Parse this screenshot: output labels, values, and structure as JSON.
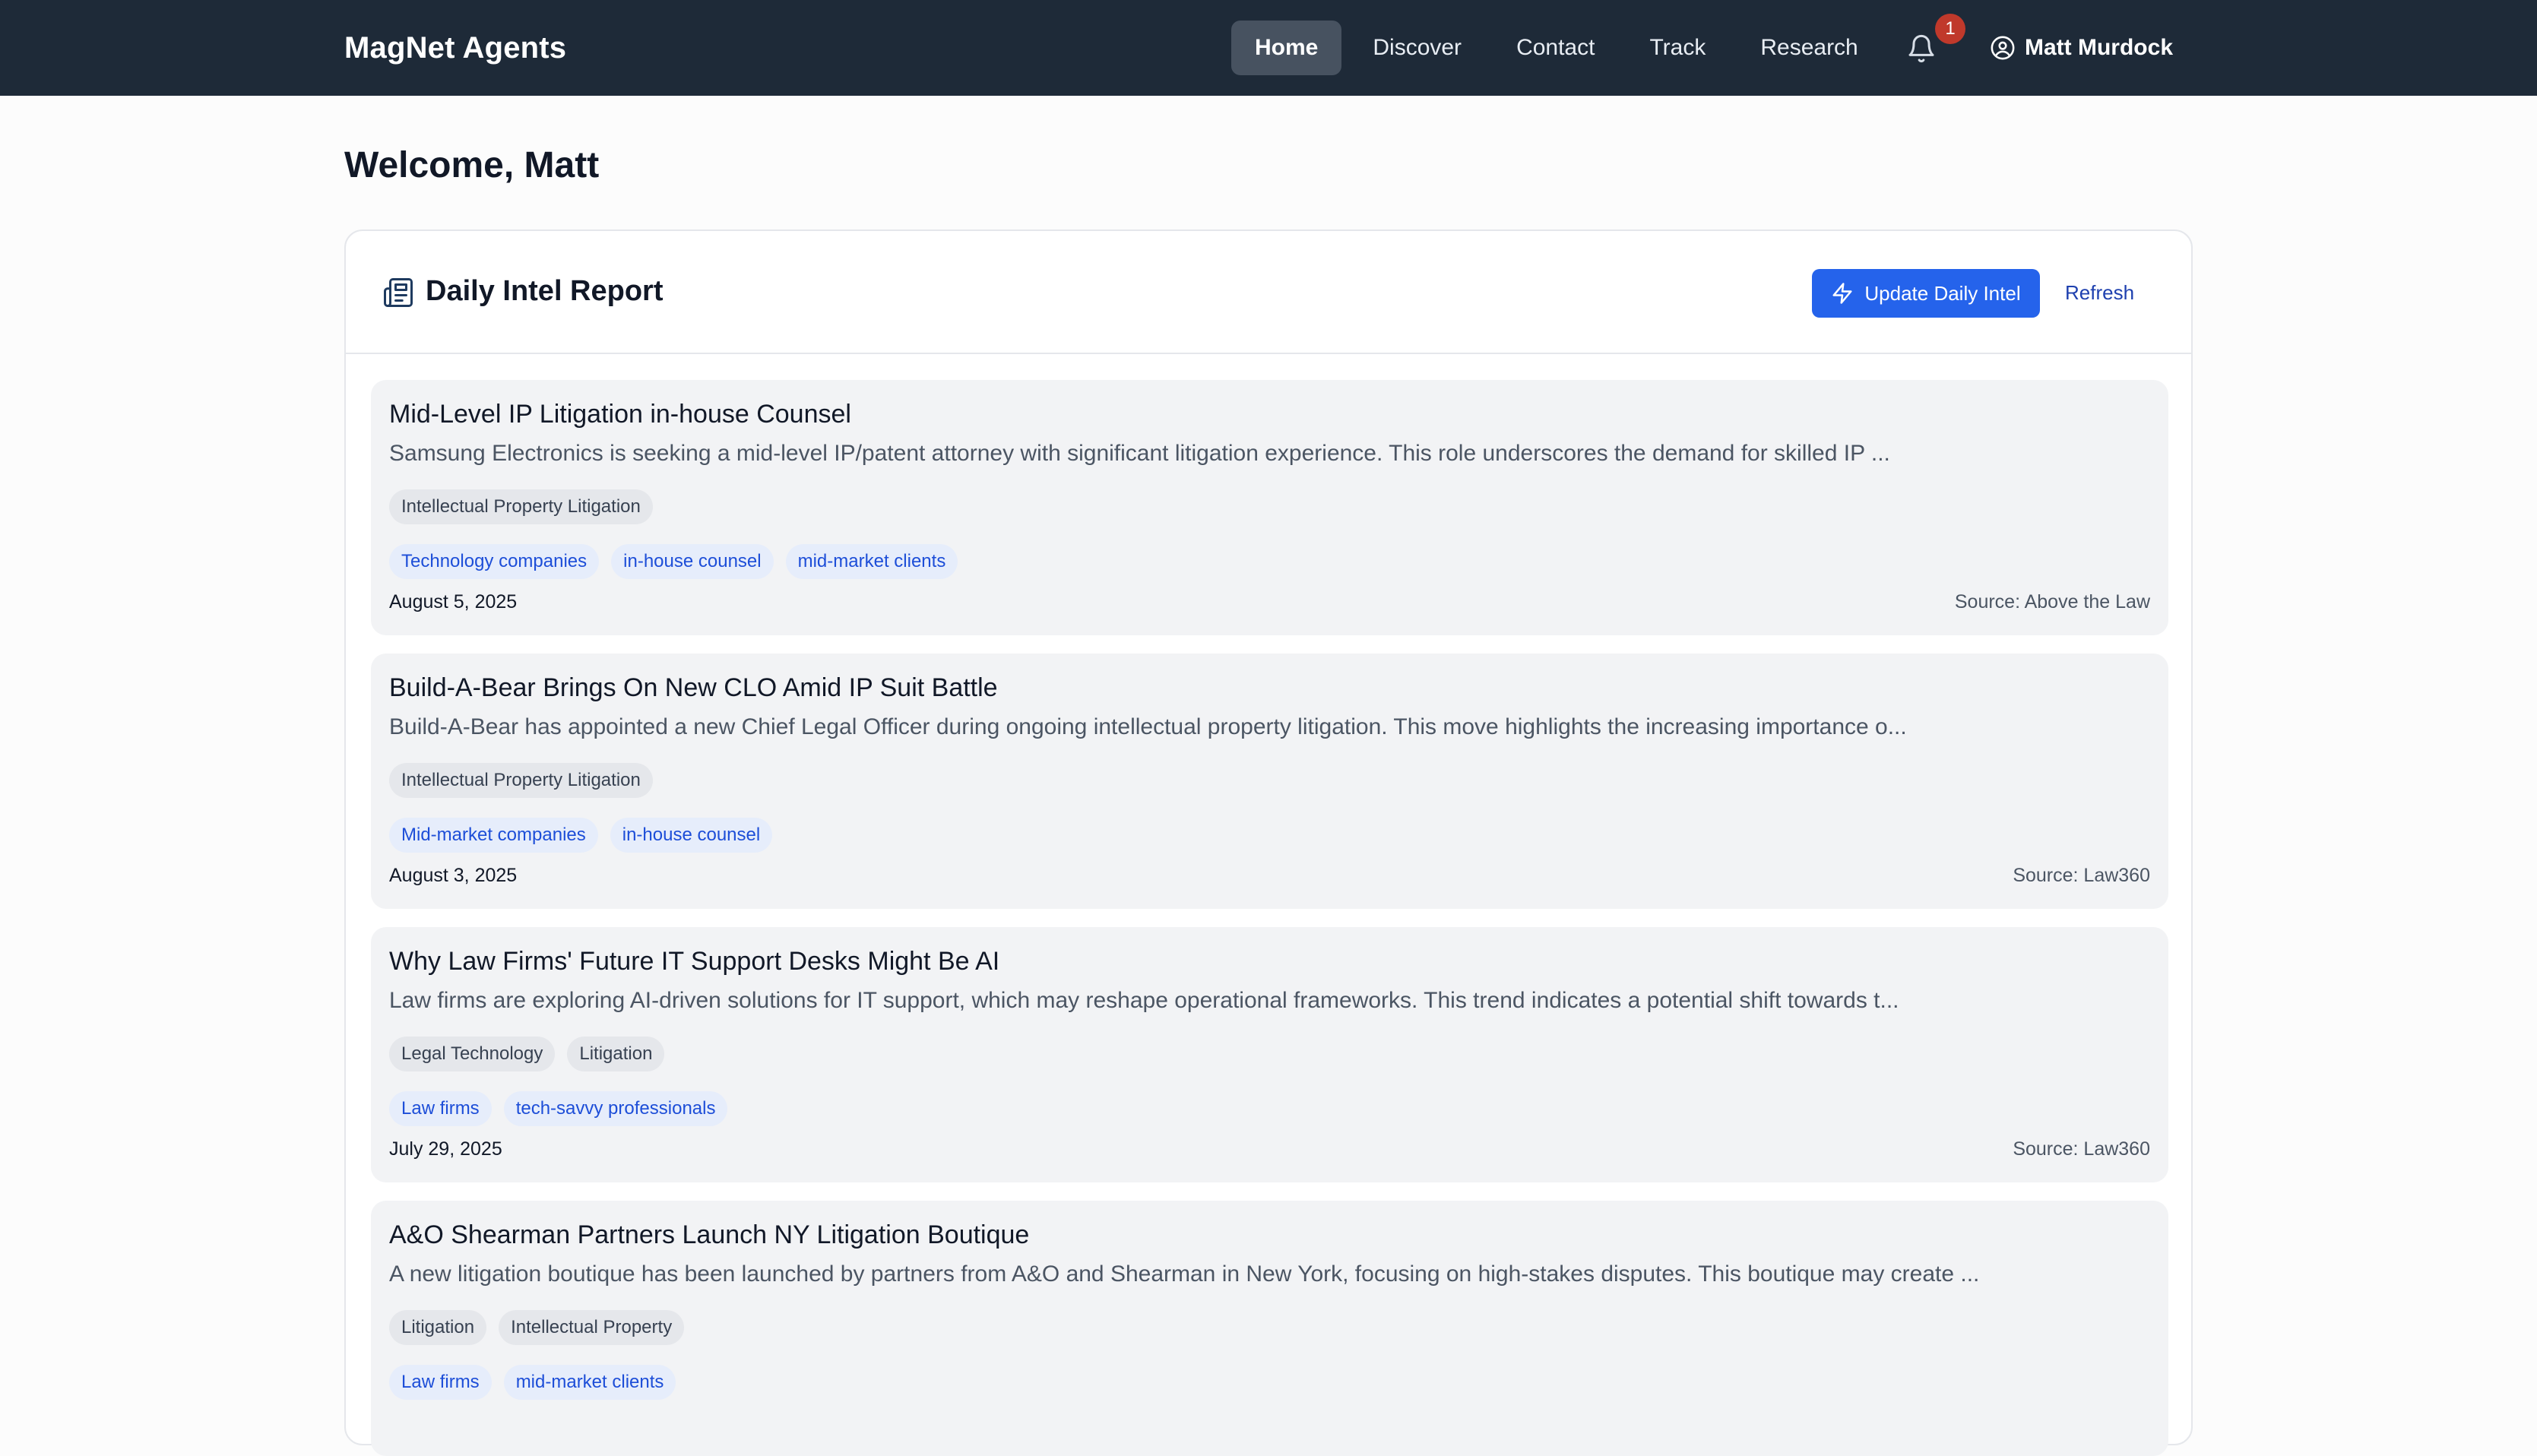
{
  "nav": {
    "brand": "MagNet Agents",
    "links": [
      {
        "label": "Home",
        "active": true
      },
      {
        "label": "Discover"
      },
      {
        "label": "Contact"
      },
      {
        "label": "Track"
      },
      {
        "label": "Research"
      }
    ],
    "notification_count": "1",
    "user_name": "Matt Murdock",
    "icons": {
      "bell": "bell-icon",
      "user": "user-circle-icon"
    }
  },
  "welcome": "Welcome, Matt",
  "report": {
    "title": "Daily Intel Report",
    "update_label": "Update Daily Intel",
    "refresh_label": "Refresh",
    "icons": {
      "title": "newspaper-icon",
      "update": "lightning-icon"
    },
    "items": [
      {
        "title": "Mid-Level IP Litigation in-house Counsel",
        "summary": "Samsung Electronics is seeking a mid-level IP/patent attorney with significant litigation experience. This role underscores the demand for skilled IP ...",
        "topics": [
          "Intellectual Property Litigation"
        ],
        "audience": [
          "Technology companies",
          "in-house counsel",
          "mid-market clients"
        ],
        "date": "August 5, 2025",
        "source": "Source: Above the Law"
      },
      {
        "title": "Build-A-Bear Brings On New CLO Amid IP Suit Battle",
        "summary": "Build-A-Bear has appointed a new Chief Legal Officer during ongoing intellectual property litigation. This move highlights the increasing importance o...",
        "topics": [
          "Intellectual Property Litigation"
        ],
        "audience": [
          "Mid-market companies",
          "in-house counsel"
        ],
        "date": "August 3, 2025",
        "source": "Source: Law360"
      },
      {
        "title": "Why Law Firms' Future IT Support Desks Might Be AI",
        "summary": "Law firms are exploring AI-driven solutions for IT support, which may reshape operational frameworks. This trend indicates a potential shift towards t...",
        "topics": [
          "Legal Technology",
          "Litigation"
        ],
        "audience": [
          "Law firms",
          "tech-savvy professionals"
        ],
        "date": "July 29, 2025",
        "source": "Source: Law360"
      },
      {
        "title": "A&O Shearman Partners Launch NY Litigation Boutique",
        "summary": "A new litigation boutique has been launched by partners from A&O and Shearman in New York, focusing on high-stakes disputes. This boutique may create ...",
        "topics": [
          "Litigation",
          "Intellectual Property"
        ],
        "audience": [
          "Law firms",
          "mid-market clients"
        ],
        "date": "",
        "source": ""
      }
    ]
  },
  "colors": {
    "navbar_bg": "#1e2a38",
    "active_nav_bg": "#475260",
    "accent": "#2563eb",
    "badge": "#c0392b",
    "item_bg": "#f2f3f5"
  }
}
